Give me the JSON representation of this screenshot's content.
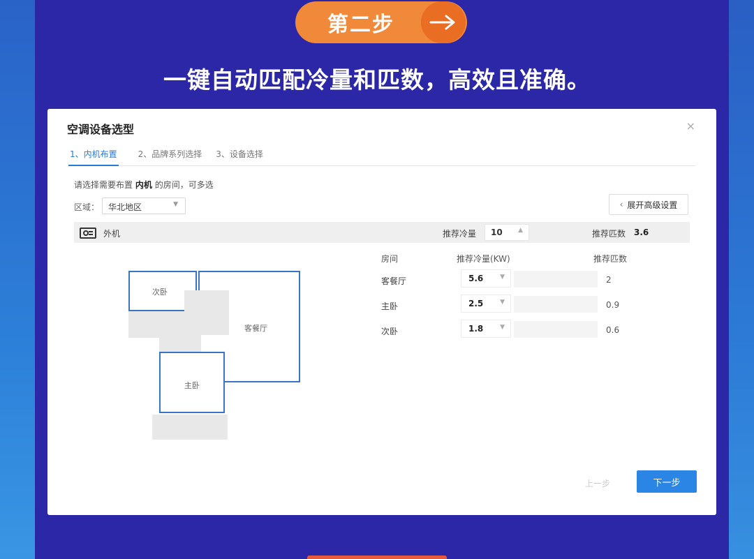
{
  "banner": {
    "step_label": "第二步",
    "headline": "一键自动匹配冷量和匹数，高效且准确。"
  },
  "dialog": {
    "title": "空调设备选型",
    "close": "×",
    "tabs": [
      {
        "label": "1、内机布置"
      },
      {
        "label": "2、品牌系列选择"
      },
      {
        "label": "3、设备选择"
      }
    ],
    "hint_prefix": "请选择需要布置",
    "hint_bold": "内机",
    "hint_suffix": "的房间，可多选",
    "region_label": "区域：",
    "region_value": "华北地区",
    "advanced_button": "展开高级设置",
    "outdoor": {
      "label": "外机",
      "rec_capacity_label": "推荐冷量",
      "rec_capacity_value": "10",
      "rec_hp_label": "推荐匹数",
      "rec_hp_value": "3.6"
    },
    "table": {
      "headers": {
        "room": "房间",
        "capacity": "推荐冷量(KW)",
        "hp": "推荐匹数"
      },
      "rows": [
        {
          "room": "客餐厅",
          "capacity": "5.6",
          "hp": "2"
        },
        {
          "room": "主卧",
          "capacity": "2.5",
          "hp": "0.9"
        },
        {
          "room": "次卧",
          "capacity": "1.8",
          "hp": "0.6"
        }
      ]
    },
    "floorplan": {
      "room_secondary": "次卧",
      "room_living": "客餐厅",
      "room_master": "主卧"
    },
    "prev_button": "上一步",
    "next_button": "下一步"
  },
  "colors": {
    "accent": "#2b85e4",
    "orange": "#f08a3a",
    "background": "#2b27a6"
  }
}
